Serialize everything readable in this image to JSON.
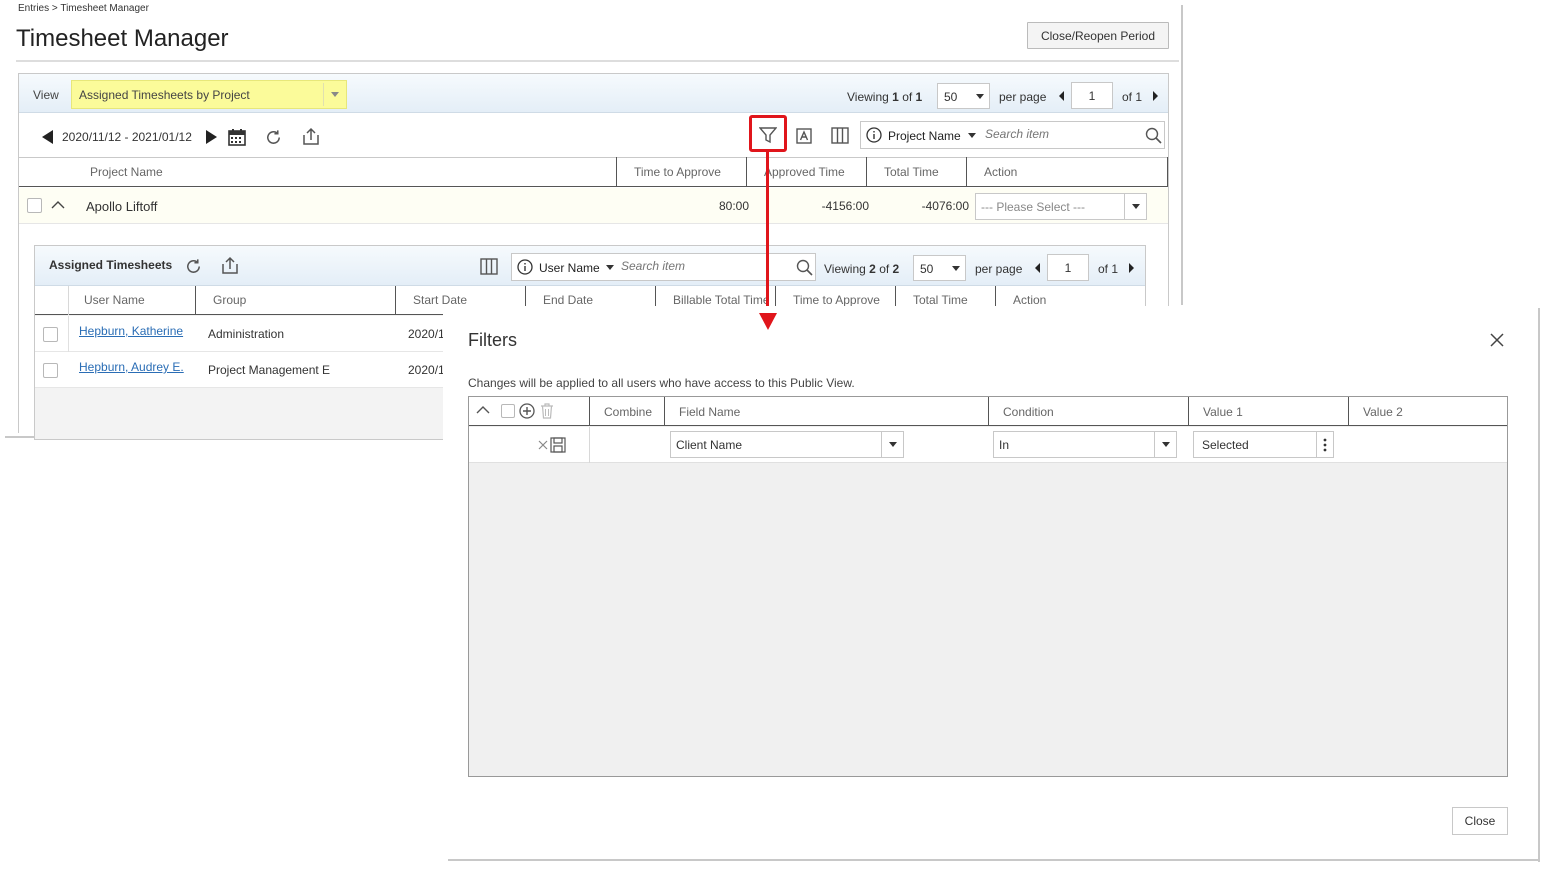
{
  "breadcrumb": "Entries > Timesheet Manager",
  "page_title": "Timesheet Manager",
  "close_reopen_label": "Close/Reopen Period",
  "view": {
    "label": "View",
    "selected": "Assigned Timesheets by Project"
  },
  "pager": {
    "viewing_prefix": "Viewing",
    "viewing_count": "1",
    "viewing_of": "of",
    "viewing_total": "1",
    "per_page_value": "50",
    "per_page_label": "per page",
    "page_value": "1",
    "page_of": "of 1"
  },
  "date_range": "2020/11/12 - 2021/01/12",
  "search": {
    "field": "Project Name",
    "placeholder": "Search item"
  },
  "columns": [
    "Project Name",
    "Time to Approve",
    "Approved Time",
    "Total Time",
    "Action"
  ],
  "project_row": {
    "name": "Apollo Liftoff",
    "time_to_approve": "80:00",
    "approved_time": "-4156:00",
    "total_time": "-4076:00",
    "action_placeholder": "--- Please Select ---"
  },
  "assigned": {
    "title": "Assigned Timesheets",
    "search_field": "User Name",
    "search_placeholder": "Search item",
    "viewing_prefix": "Viewing",
    "viewing_count": "2",
    "viewing_of": "of",
    "viewing_total": "2",
    "per_page_value": "50",
    "per_page_label": "per page",
    "page_value": "1",
    "page_of": "of 1",
    "columns": [
      "User Name",
      "Group",
      "Start Date",
      "End Date",
      "Billable Total Time",
      "Time to Approve",
      "Total Time",
      "Action"
    ],
    "rows": [
      {
        "user": "Hepburn, Katherine",
        "group": "Administration",
        "start": "2020/1"
      },
      {
        "user": "Hepburn, Audrey E.",
        "group": "Project Management E",
        "start": "2020/1"
      }
    ]
  },
  "filters": {
    "title": "Filters",
    "note": "Changes will be applied to all users who have access to this Public View.",
    "columns": [
      "Combine",
      "Field Name",
      "Condition",
      "Value 1",
      "Value 2"
    ],
    "row": {
      "field_name": "Client Name",
      "condition": "In",
      "value1": "Selected"
    },
    "close_label": "Close"
  },
  "colors": {
    "highlight_red": "#e0151b",
    "view_yellow": "#fbfb9a",
    "link_blue": "#2a6db5"
  }
}
